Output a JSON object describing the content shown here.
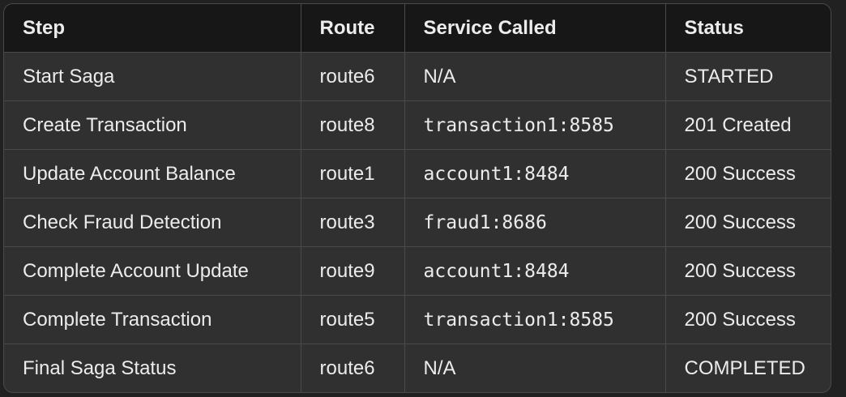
{
  "table": {
    "headers": [
      "Step",
      "Route",
      "Service Called",
      "Status"
    ],
    "rows": [
      {
        "step": "Start Saga",
        "route": "route6",
        "service": "N/A",
        "service_code": false,
        "status": "STARTED"
      },
      {
        "step": "Create Transaction",
        "route": "route8",
        "service": "transaction1:8585",
        "service_code": true,
        "status": "201 Created"
      },
      {
        "step": "Update Account Balance",
        "route": "route1",
        "service": "account1:8484",
        "service_code": true,
        "status": "200 Success"
      },
      {
        "step": "Check Fraud Detection",
        "route": "route3",
        "service": "fraud1:8686",
        "service_code": true,
        "status": "200 Success"
      },
      {
        "step": "Complete Account Update",
        "route": "route9",
        "service": "account1:8484",
        "service_code": true,
        "status": "200 Success"
      },
      {
        "step": "Complete Transaction",
        "route": "route5",
        "service": "transaction1:8585",
        "service_code": true,
        "status": "200 Success"
      },
      {
        "step": "Final Saga Status",
        "route": "route6",
        "service": "N/A",
        "service_code": false,
        "status": "COMPLETED"
      }
    ]
  },
  "colors": {
    "background": "#212121",
    "header_bg": "#171717",
    "body_bg": "#303030",
    "border": "#4a4a4a",
    "text": "#ececec"
  }
}
